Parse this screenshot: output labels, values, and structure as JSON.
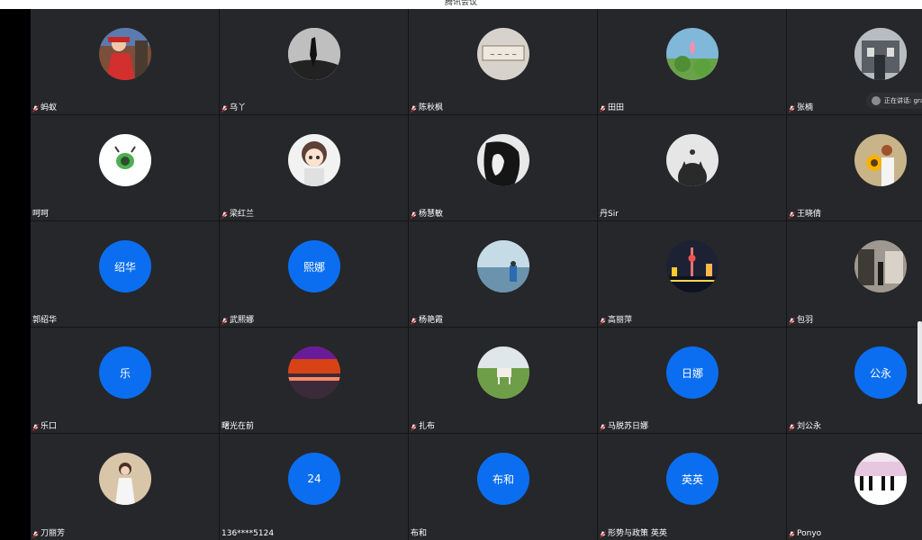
{
  "window": {
    "title": "腾讯会议"
  },
  "speaker_badge": {
    "text": "正在讲话: gra"
  },
  "participants": [
    {
      "name": "蚂蚁",
      "muted": true,
      "avatar": "photo-girl-red-dress",
      "bg": "#7b4f3a"
    },
    {
      "name": "乌丫",
      "muted": true,
      "avatar": "photo-bw-dancer",
      "bg": "#cfcfcf"
    },
    {
      "name": "陈秋枫",
      "muted": true,
      "avatar": "photo-calligraphy",
      "bg": "#d7d3cc"
    },
    {
      "name": "田田",
      "muted": true,
      "avatar": "photo-lotus",
      "bg": "#7fb8d8"
    },
    {
      "name": "张楠",
      "muted": true,
      "avatar": "photo-building",
      "bg": "#8a8f94"
    },
    {
      "name": "呵呵",
      "muted": false,
      "avatar": "photo-bug-cartoon",
      "bg": "#ffffff"
    },
    {
      "name": "梁红兰",
      "muted": true,
      "avatar": "photo-cartoon-girl",
      "bg": "#f2f2f2"
    },
    {
      "name": "杨慧敏",
      "muted": true,
      "avatar": "photo-bw-portrait",
      "bg": "#e8e8e8"
    },
    {
      "name": "丹Sir",
      "muted": false,
      "avatar": "photo-cat",
      "bg": "#e6e6e6"
    },
    {
      "name": "王晓倩",
      "muted": true,
      "avatar": "photo-sunflower-girl",
      "bg": "#c9b48a"
    },
    {
      "name": "郭绍华",
      "muted": false,
      "avatar_text": "绍华"
    },
    {
      "name": "武熙娜",
      "muted": true,
      "avatar_text": "熙娜"
    },
    {
      "name": "杨艳霞",
      "muted": true,
      "avatar": "photo-seaside",
      "bg": "#8fb4c9"
    },
    {
      "name": "高丽萍",
      "muted": true,
      "avatar": "photo-night-city",
      "bg": "#1c2233"
    },
    {
      "name": "包羽",
      "muted": true,
      "avatar": "photo-street",
      "bg": "#6f6a64"
    },
    {
      "name": "乐口",
      "muted": true,
      "avatar_text": "乐"
    },
    {
      "name": "曙光在前",
      "muted": false,
      "avatar": "photo-sunset",
      "bg": "#a23a2a"
    },
    {
      "name": "扎布",
      "muted": true,
      "avatar": "photo-horse-grass",
      "bg": "#7a9a52"
    },
    {
      "name": "马脱苏日娜",
      "muted": true,
      "avatar_text": "日娜"
    },
    {
      "name": "刘公永",
      "muted": true,
      "avatar_text": "公永"
    },
    {
      "name": "刀丽芳",
      "muted": true,
      "avatar": "photo-woman-white",
      "bg": "#d9c6a8"
    },
    {
      "name": "136****5124",
      "muted": false,
      "avatar_text": "24"
    },
    {
      "name": "布和",
      "muted": false,
      "avatar_text": "布和"
    },
    {
      "name": "形势与政策 英英",
      "muted": true,
      "avatar_text": "英英"
    },
    {
      "name": "Ponyo",
      "muted": true,
      "avatar": "photo-piano",
      "bg": "#efe7ee"
    }
  ],
  "colors": {
    "tile": "#26272b",
    "avatar_blue": "#0b6ef0",
    "mic_red": "#e02424"
  }
}
